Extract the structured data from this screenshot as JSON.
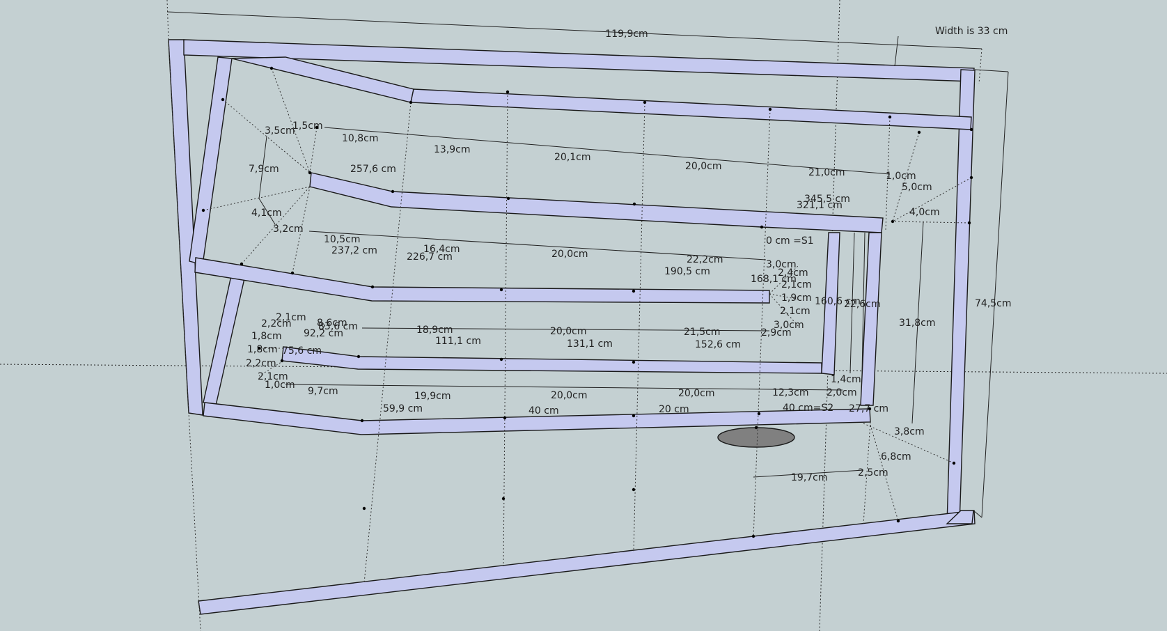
{
  "colors": {
    "background": "#c4d0d2",
    "board_fill": "#c5c9ef",
    "edge": "#1a1a1a",
    "port": "#808080"
  },
  "labels": {
    "overall_width": "119,9cm",
    "width_note": "Width is 33 cm",
    "overall_height": "74,5cm",
    "top": {
      "seg1": "10,8cm",
      "seg2": "13,9cm",
      "seg3": "20,1cm",
      "seg4": "20,0cm",
      "seg5": "21,0cm",
      "c1": "3,5cm",
      "c2": "1,5cm",
      "c3": "7,9cm",
      "c4": "4,1cm",
      "c5": "3,2cm",
      "d1": "257,6 cm",
      "rc1": "1,0cm",
      "rc2": "5,0cm",
      "rc3": "4,0cm",
      "d2": "345,5 cm",
      "d3": "321,1 cm"
    },
    "mid": {
      "seg1": "10,5cm",
      "seg2": "16,4cm",
      "seg3": "20,0cm",
      "seg4": "22,2cm",
      "d1": "237,2 cm",
      "d2": "226,7 cm",
      "d3": "190,5 cm",
      "d4": "168,1 cm",
      "s1": "0 cm =S1",
      "r1": "3,0cm",
      "r2": "2,4cm",
      "r3": "2,1cm",
      "r4": "1,9cm",
      "r5": "2,1cm",
      "r6": "3,0cm",
      "r7": "2,9cm",
      "h1": "160,6 cm",
      "h2": "22,6cm",
      "h3": "31,8cm"
    },
    "low": {
      "seg1": "8,6cm",
      "seg2": "18,9cm",
      "seg3": "20,0cm",
      "seg4": "21,5cm",
      "d1": "83,6 cm",
      "d2": "92,2 cm",
      "d3": "111,1 cm",
      "d4": "131,1 cm",
      "d5": "152,6 cm",
      "d6": "75,6 cm",
      "l1": "2,1cm",
      "l2": "2,2cm",
      "l3": "1,8cm",
      "l4": "1,8cm",
      "l5": "2,2cm",
      "l6": "2,1cm",
      "l7": "1,0cm"
    },
    "bottom": {
      "seg1": "9,7cm",
      "seg2": "19,9cm",
      "seg3": "20,0cm",
      "seg4": "20,0cm",
      "seg5": "12,3cm",
      "b1": "1,4cm",
      "b2": "2,0cm",
      "d1": "59,9 cm",
      "d2": "40 cm",
      "d3": "20 cm",
      "s2": "40 cm=S2",
      "d4": "27,7 cm",
      "e1": "3,8cm",
      "e2": "6,8cm",
      "e3": "19,7cm",
      "e4": "2,5cm"
    }
  }
}
